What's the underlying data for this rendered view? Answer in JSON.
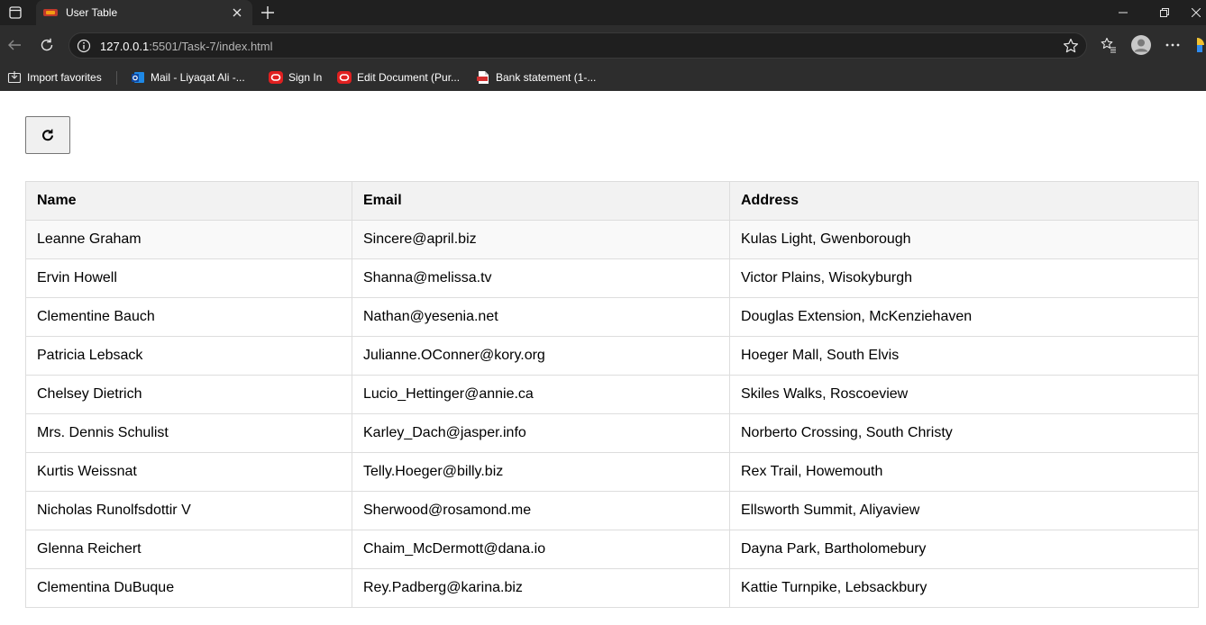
{
  "browser": {
    "tab_title": "User Table",
    "url_host": "127.0.0.1",
    "url_path": ":5501/Task-7/index.html",
    "bookmarks": [
      {
        "label": "Import favorites",
        "icon": "import-icon"
      },
      {
        "label": "Mail - Liyaqat Ali -...",
        "icon": "outlook-icon"
      },
      {
        "label": "Sign In",
        "icon": "oracle-icon"
      },
      {
        "label": "Edit Document (Pur...",
        "icon": "oracle-icon"
      },
      {
        "label": "Bank statement (1-...",
        "icon": "pdf-icon"
      }
    ]
  },
  "page": {
    "refresh_icon": "refresh-icon",
    "table": {
      "headers": [
        "Name",
        "Email",
        "Address"
      ],
      "rows": [
        [
          "Leanne Graham",
          "Sincere@april.biz",
          "Kulas Light, Gwenborough"
        ],
        [
          "Ervin Howell",
          "Shanna@melissa.tv",
          "Victor Plains, Wisokyburgh"
        ],
        [
          "Clementine Bauch",
          "Nathan@yesenia.net",
          "Douglas Extension, McKenziehaven"
        ],
        [
          "Patricia Lebsack",
          "Julianne.OConner@kory.org",
          "Hoeger Mall, South Elvis"
        ],
        [
          "Chelsey Dietrich",
          "Lucio_Hettinger@annie.ca",
          "Skiles Walks, Roscoeview"
        ],
        [
          "Mrs. Dennis Schulist",
          "Karley_Dach@jasper.info",
          "Norberto Crossing, South Christy"
        ],
        [
          "Kurtis Weissnat",
          "Telly.Hoeger@billy.biz",
          "Rex Trail, Howemouth"
        ],
        [
          "Nicholas Runolfsdottir V",
          "Sherwood@rosamond.me",
          "Ellsworth Summit, Aliyaview"
        ],
        [
          "Glenna Reichert",
          "Chaim_McDermott@dana.io",
          "Dayna Park, Bartholomebury"
        ],
        [
          "Clementina DuBuque",
          "Rey.Padberg@karina.biz",
          "Kattie Turnpike, Lebsackbury"
        ]
      ]
    }
  },
  "colors": {
    "chrome_dark": "#202020",
    "chrome_toolbar": "#2d2d2d",
    "table_header_bg": "#f2f2f2",
    "table_border": "#dddddd"
  }
}
